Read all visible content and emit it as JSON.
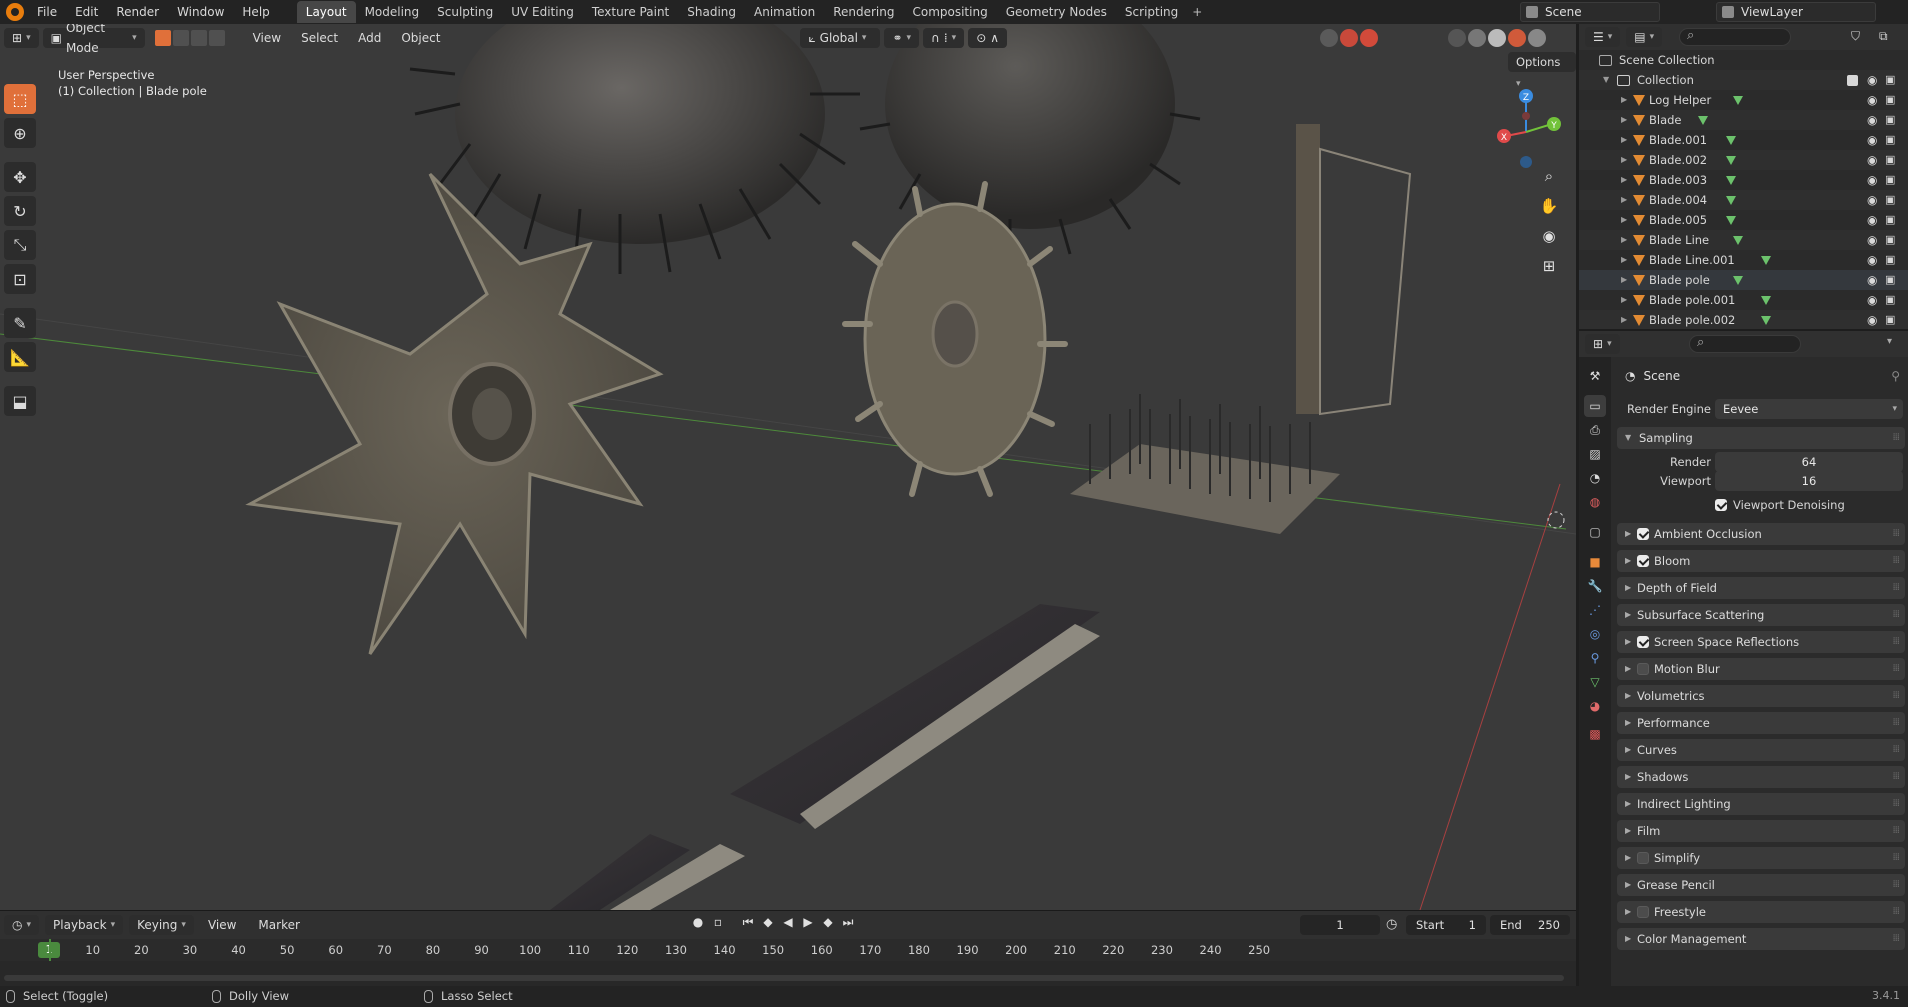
{
  "menubar": {
    "items": [
      "File",
      "Edit",
      "Render",
      "Window",
      "Help"
    ],
    "workspaces": [
      "Layout",
      "Modeling",
      "Sculpting",
      "UV Editing",
      "Texture Paint",
      "Shading",
      "Animation",
      "Rendering",
      "Compositing",
      "Geometry Nodes",
      "Scripting"
    ],
    "active_workspace": "Layout",
    "add_tab": "+",
    "scene": "Scene",
    "view_layer": "ViewLayer"
  },
  "viewport": {
    "mode": "Object Mode",
    "menus": [
      "View",
      "Select",
      "Add",
      "Object"
    ],
    "orientation": "Global",
    "options": "Options",
    "perspective_label": "User Perspective",
    "collection_label": "(1) Collection | Blade pole",
    "gizmo_axes": {
      "x": "X",
      "y": "Y",
      "z": "Z"
    }
  },
  "timeline": {
    "playback": "Playback",
    "keying": "Keying",
    "view": "View",
    "marker": "Marker",
    "current_frame": "1",
    "start_label": "Start",
    "start": "1",
    "end_label": "End",
    "end": "250",
    "ruler_current": "1",
    "ticks": [
      "10",
      "20",
      "30",
      "40",
      "50",
      "60",
      "70",
      "80",
      "90",
      "100",
      "110",
      "120",
      "130",
      "140",
      "150",
      "160",
      "170",
      "180",
      "190",
      "200",
      "210",
      "220",
      "230",
      "240",
      "250"
    ]
  },
  "statusbar": {
    "select": "Select (Toggle)",
    "dolly": "Dolly View",
    "lasso": "Lasso Select",
    "version": "3.4.1"
  },
  "outliner": {
    "scene_collection": "Scene Collection",
    "collection": "Collection",
    "items": [
      "Log Helper",
      "Blade",
      "Blade.001",
      "Blade.002",
      "Blade.003",
      "Blade.004",
      "Blade.005",
      "Blade Line",
      "Blade Line.001",
      "Blade pole",
      "Blade pole.001",
      "Blade pole.002"
    ]
  },
  "properties": {
    "context": "Scene",
    "render_engine_label": "Render Engine",
    "render_engine": "Eevee",
    "sampling": {
      "title": "Sampling",
      "render_label": "Render",
      "render": "64",
      "viewport_label": "Viewport",
      "viewport": "16",
      "denoise_label": "Viewport Denoising"
    },
    "panels": [
      {
        "label": "Ambient Occlusion",
        "check": true
      },
      {
        "label": "Bloom",
        "check": true
      },
      {
        "label": "Depth of Field",
        "check": null
      },
      {
        "label": "Subsurface Scattering",
        "check": null
      },
      {
        "label": "Screen Space Reflections",
        "check": true
      },
      {
        "label": "Motion Blur",
        "check": false
      },
      {
        "label": "Volumetrics",
        "check": null
      },
      {
        "label": "Performance",
        "check": null
      },
      {
        "label": "Curves",
        "check": null
      },
      {
        "label": "Shadows",
        "check": null
      },
      {
        "label": "Indirect Lighting",
        "check": null
      },
      {
        "label": "Film",
        "check": null
      },
      {
        "label": "Simplify",
        "check": false
      },
      {
        "label": "Grease Pencil",
        "check": null
      },
      {
        "label": "Freestyle",
        "check": false
      },
      {
        "label": "Color Management",
        "check": null
      }
    ]
  },
  "colors": {
    "accent": "#e0703a",
    "x_axis": "#e04a4a",
    "y_axis": "#72c23a",
    "z_axis": "#3a8ce0",
    "frame": "#4a8a3e"
  }
}
